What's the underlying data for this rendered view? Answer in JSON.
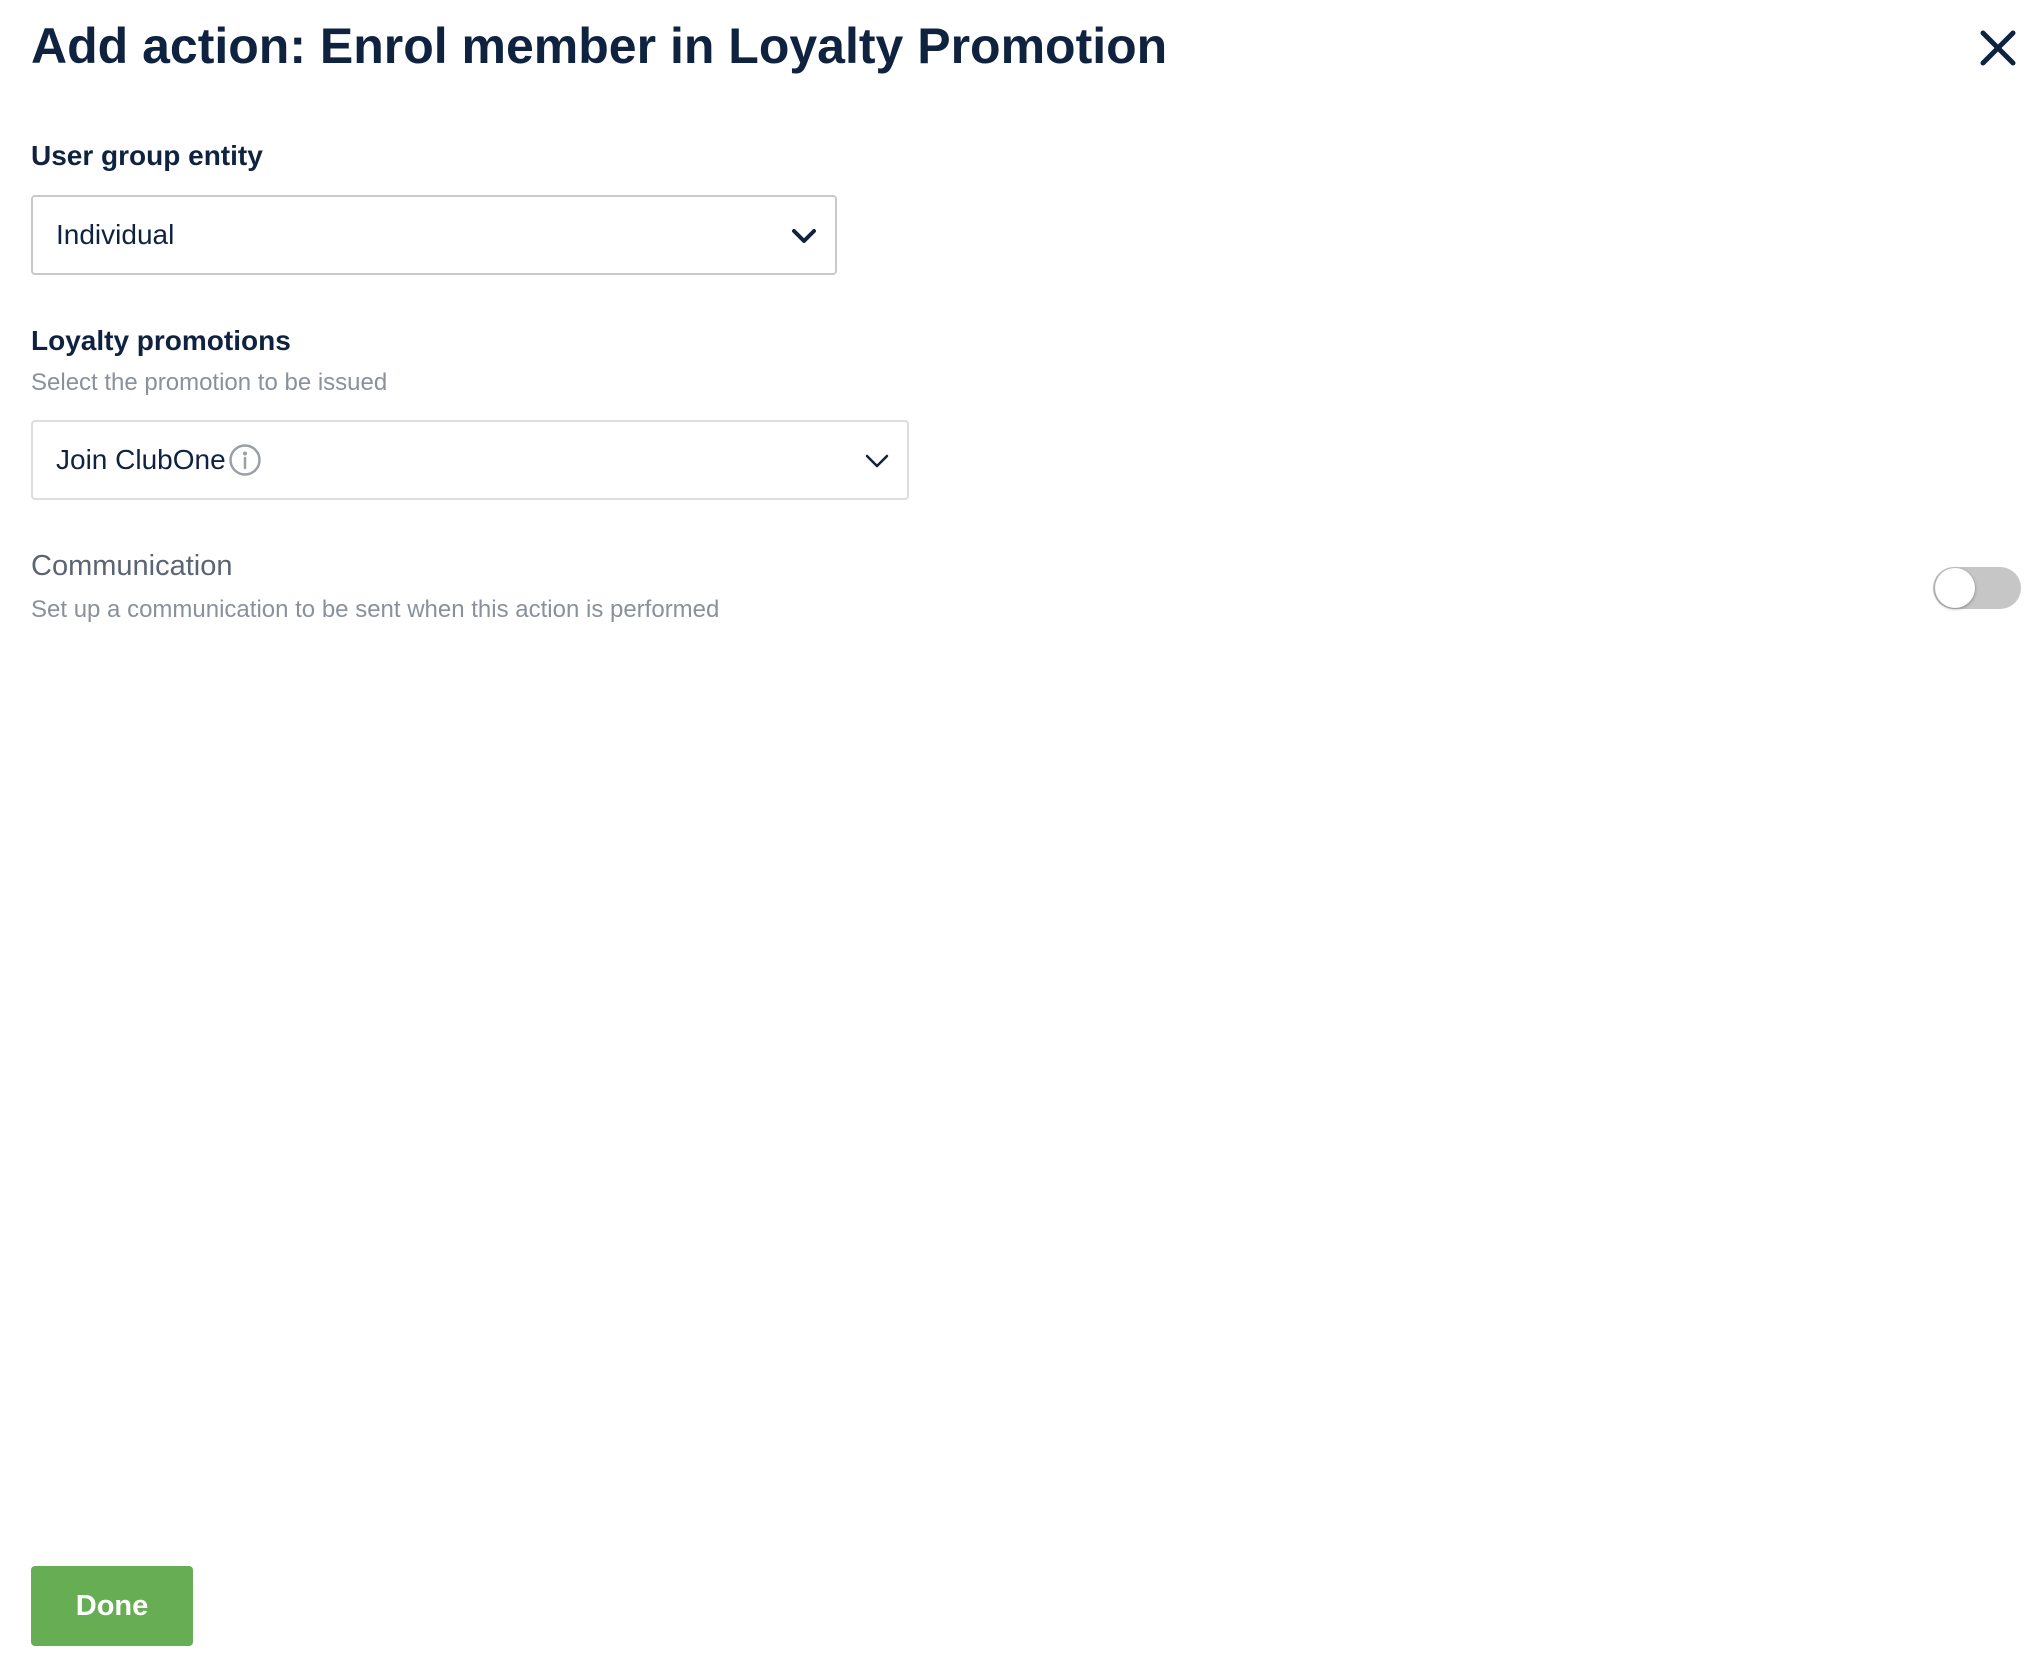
{
  "dialog": {
    "title": "Add action: Enrol member in Loyalty Promotion",
    "close_icon": "close-icon"
  },
  "user_group": {
    "label": "User group entity",
    "selected": "Individual",
    "icon": "chevron-down-icon"
  },
  "promotions": {
    "label": "Loyalty promotions",
    "help": "Select the promotion to be issued",
    "selected": "Join ClubOne",
    "info_icon": "info-icon",
    "icon": "chevron-down-icon"
  },
  "communication": {
    "label": "Communication",
    "help": "Set up a communication to be sent when this action is performed",
    "enabled": false
  },
  "footer": {
    "done_label": "Done"
  },
  "colors": {
    "primary_text": "#0f2341",
    "muted_text": "#8a919c",
    "done_button": "#67ad53",
    "toggle_off": "#c6c6c6"
  }
}
